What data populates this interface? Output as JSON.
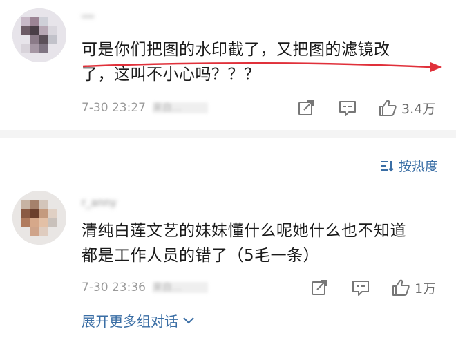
{
  "comments": [
    {
      "username": "ᵤᵤᵤ",
      "text_lines": [
        "可是你们把图的水印截了，又把图的滤镜改",
        "了，这叫不小心吗？？？"
      ],
      "timestamp": "7-30 23:27",
      "source": "来自…",
      "likes": "3.4万"
    },
    {
      "username": "r_anny",
      "text_lines": [
        "清纯白莲文艺的妹妹懂什么呢她什么也不知道",
        "都是工作人员的错了（5毛一条）"
      ],
      "timestamp": "7-30 23:36",
      "source": "来自…",
      "likes": "1万"
    }
  ],
  "sort": {
    "label": "按热度"
  },
  "expand": {
    "label": "展开更多组对话"
  },
  "colors": {
    "link": "#3a6ea5",
    "annotation": "#e0303a"
  },
  "icons": [
    "share-icon",
    "comment-icon",
    "like-icon",
    "sort-icon",
    "chevron-down-icon",
    "arrow-icon"
  ]
}
